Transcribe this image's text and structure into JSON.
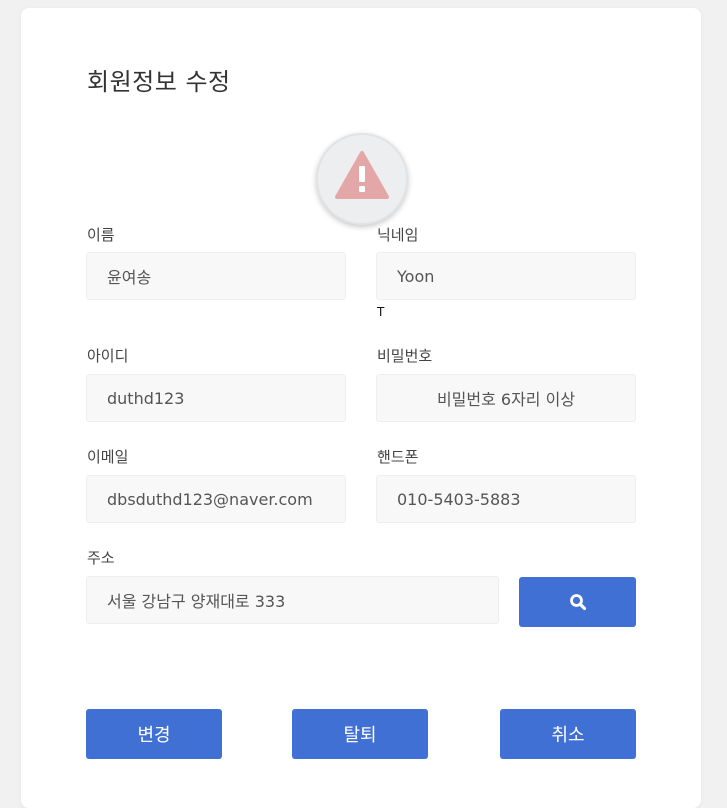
{
  "page": {
    "title": "회원정보 수정"
  },
  "avatar": {
    "icon": "warning-icon",
    "icon_color": "#e4a7a7"
  },
  "form": {
    "name": {
      "label": "이름",
      "value": "윤여송"
    },
    "nickname": {
      "label": "닉네임",
      "value": "Yoon",
      "hint": "T"
    },
    "user_id": {
      "label": "아이디",
      "value": "duthd123"
    },
    "password": {
      "label": "비밀번호",
      "placeholder": "비밀번호 6자리 이상"
    },
    "email": {
      "label": "이메일",
      "value": "dbsduthd123@naver.com"
    },
    "phone": {
      "label": "핸드폰",
      "value": "010-5403-5883"
    },
    "address": {
      "label": "주소",
      "value": "서울 강남구 양재대로 333",
      "search_icon": "search-icon"
    }
  },
  "actions": {
    "update_label": "변경",
    "withdraw_label": "탈퇴",
    "cancel_label": "취소"
  },
  "colors": {
    "accent": "#4170d5",
    "background": "#f1f1f1",
    "card": "#ffffff",
    "field_background": "#f8f8f8"
  }
}
